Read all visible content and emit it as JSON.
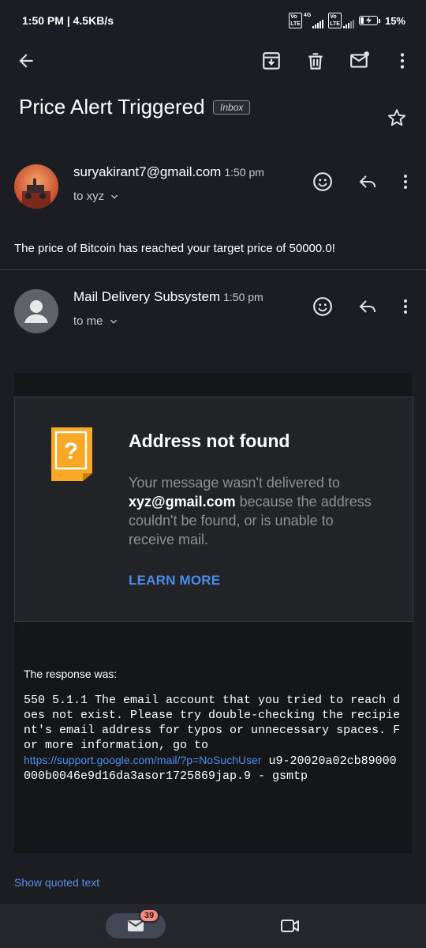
{
  "status_bar": {
    "time": "1:50 PM",
    "speed": "4.5KB/s",
    "sim1_label": "4G",
    "battery": "15%"
  },
  "toolbar": {
    "back": "back-icon",
    "archive": "archive-icon",
    "delete": "delete-icon",
    "mark_unread": "mark-unread-icon",
    "more": "more-vert-icon"
  },
  "email": {
    "subject": "Price Alert Triggered",
    "label": "Inbox"
  },
  "messages": [
    {
      "sender": "suryakirant7@gmail.com",
      "time": "1:50 pm",
      "recipient": "to xyz",
      "snippet": "The price of Bitcoin has reached your target price of 50000.0!"
    },
    {
      "sender": "Mail Delivery Subsystem",
      "time": "1:50 pm",
      "recipient": "to me"
    }
  ],
  "bounce": {
    "title": "Address not found",
    "body_before": "Your message wasn't delivered to ",
    "address": "xyz@gmail.com",
    "body_after": " because the address couldn't be found, or is unable to receive mail.",
    "learn_more": "LEARN MORE",
    "response_label": "The response was:",
    "response_before": "550 5.1.1 The email account that you tried to reach does not exist. Please try double-checking the recipient's email address for typos or unnecessary spaces. For more information, go to\n",
    "response_link": "https://support.google.com/mail/?p=NoSuchUser",
    "response_after": " u9-20020a02cb89000000b0046e9d16da3asor1725869jap.9 - gsmtp"
  },
  "show_quoted": "Show quoted text",
  "bottom_nav": {
    "mail_badge": "39"
  },
  "colors": {
    "background": "#1c1d22",
    "accent_link": "#4a8cf0",
    "badge": "#f28b82",
    "warning": "#f9a825"
  }
}
